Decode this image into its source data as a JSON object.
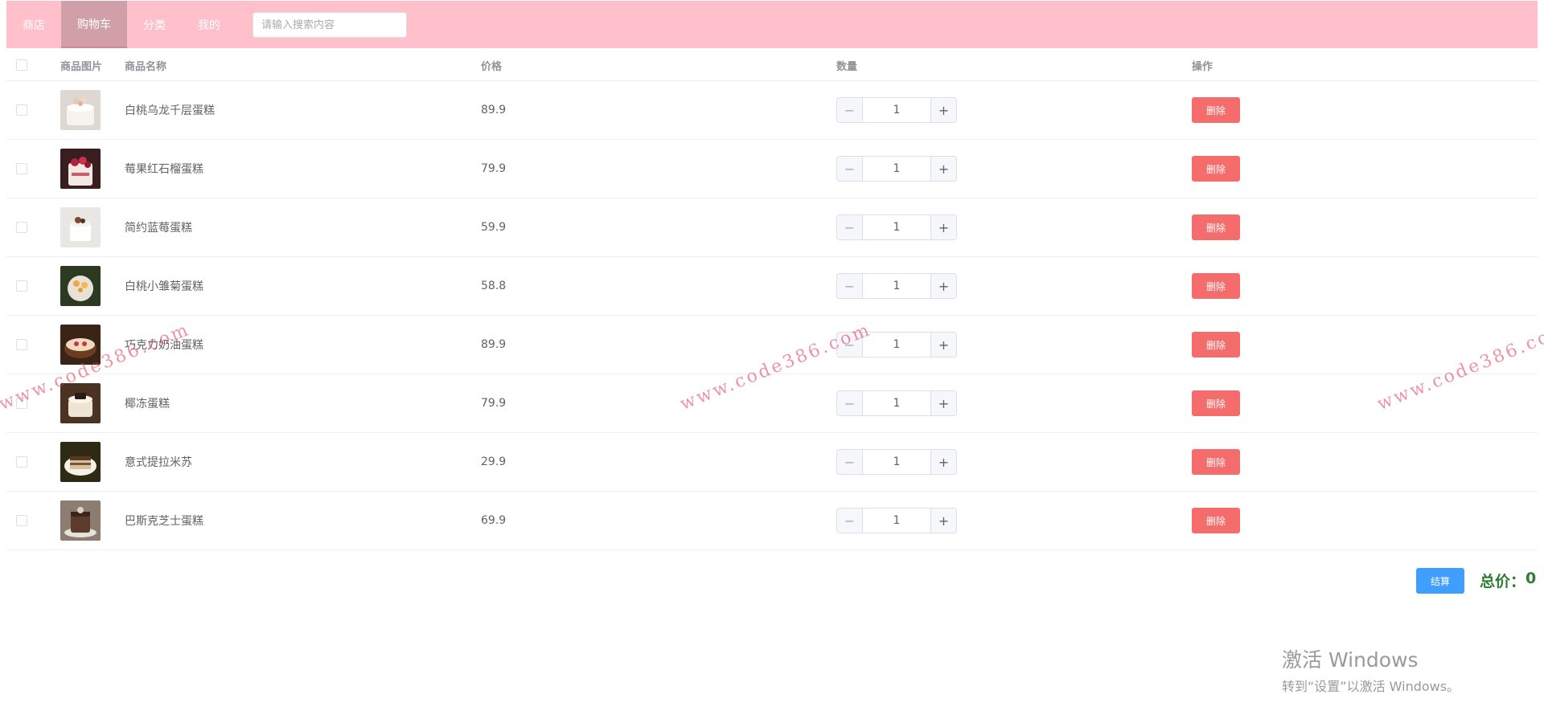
{
  "nav": {
    "items": [
      {
        "label": "商店",
        "active": false
      },
      {
        "label": "购物车",
        "active": true
      },
      {
        "label": "分类",
        "active": false
      },
      {
        "label": "我的",
        "active": false
      }
    ],
    "search_placeholder": "请输入搜索内容"
  },
  "table": {
    "headers": {
      "image": "商品图片",
      "name": "商品名称",
      "price": "价格",
      "quantity": "数量",
      "operation": "操作"
    },
    "rows": [
      {
        "name": "白桃乌龙千层蛋糕",
        "price": "89.9",
        "quantity": "1",
        "delete_label": "删除"
      },
      {
        "name": "莓果红石榴蛋糕",
        "price": "79.9",
        "quantity": "1",
        "delete_label": "删除"
      },
      {
        "name": "简约蓝莓蛋糕",
        "price": "59.9",
        "quantity": "1",
        "delete_label": "删除"
      },
      {
        "name": "白桃小雏菊蛋糕",
        "price": "58.8",
        "quantity": "1",
        "delete_label": "删除"
      },
      {
        "name": "巧克力奶油蛋糕",
        "price": "89.9",
        "quantity": "1",
        "delete_label": "删除"
      },
      {
        "name": "椰冻蛋糕",
        "price": "79.9",
        "quantity": "1",
        "delete_label": "删除"
      },
      {
        "name": "意式提拉米苏",
        "price": "29.9",
        "quantity": "1",
        "delete_label": "删除"
      },
      {
        "name": "巴斯克芝士蛋糕",
        "price": "69.9",
        "quantity": "1",
        "delete_label": "删除"
      }
    ]
  },
  "footer": {
    "checkout_label": "结算",
    "total_label": "总价：",
    "total_value": "0"
  },
  "watermark": "www.code386.com",
  "windows_activation": {
    "line1": "激活 Windows",
    "line2": "转到“设置”以激活 Windows。"
  },
  "colors": {
    "nav_bg": "#ffc0cb",
    "nav_active_bg": "#d09fa7",
    "delete_button": "#f56c6c",
    "checkout_button": "#409eff",
    "total_text": "#2e7d32"
  }
}
